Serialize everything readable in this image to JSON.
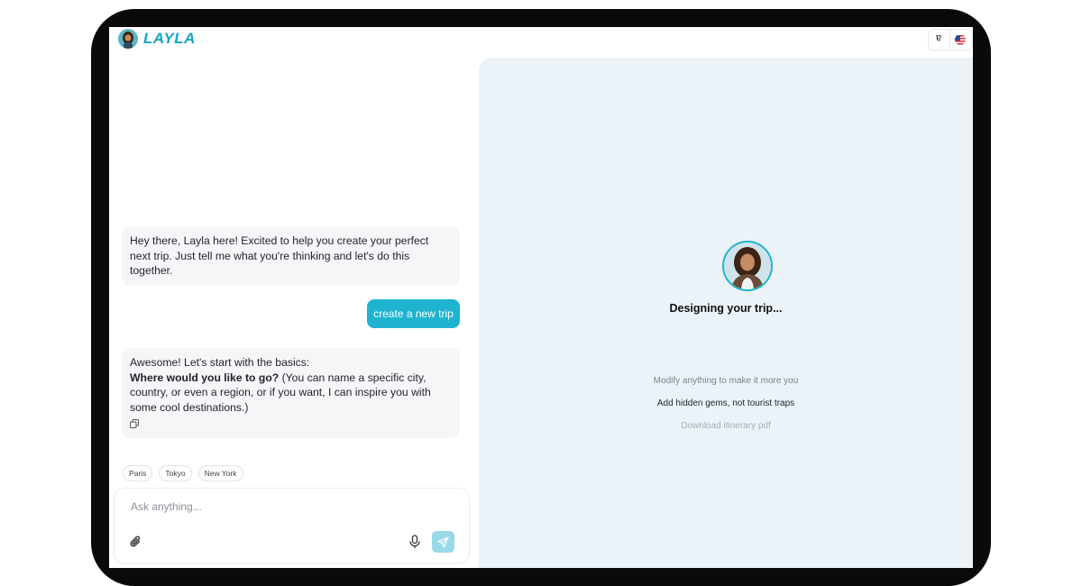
{
  "app": {
    "logo_text": "LAYLA"
  },
  "header": {
    "language": "ɐ"
  },
  "chat": {
    "intro": "Hey there, Layla here! Excited to help you create your perfect next trip. Just tell me what you're thinking and let's do this together.",
    "user_message": "create a new trip",
    "reply_line1": "Awesome! Let's start with the basics:",
    "reply_bold": "Where would you like to go?",
    "reply_rest": " (You can name a specific city, country, or even a region, or if you want, I can inspire you with some cool destinations.)"
  },
  "suggestions": [
    "Paris",
    "Tokyo",
    "New York"
  ],
  "composer": {
    "placeholder": "Ask anything..."
  },
  "panel": {
    "status": "Designing your trip...",
    "features": [
      "Modify anything to make it more you",
      "Add hidden gems, not tourist traps",
      "Download itinerary pdf"
    ]
  },
  "colors": {
    "accent": "#1fb3cf",
    "send_disabled": "#9ad9e6",
    "panel_bg": "#ebf3f8",
    "bot_bubble": "#f6f5f8"
  },
  "icons": [
    "attach-icon",
    "microphone-icon",
    "send-icon",
    "copy-icon",
    "us-flag-icon"
  ]
}
